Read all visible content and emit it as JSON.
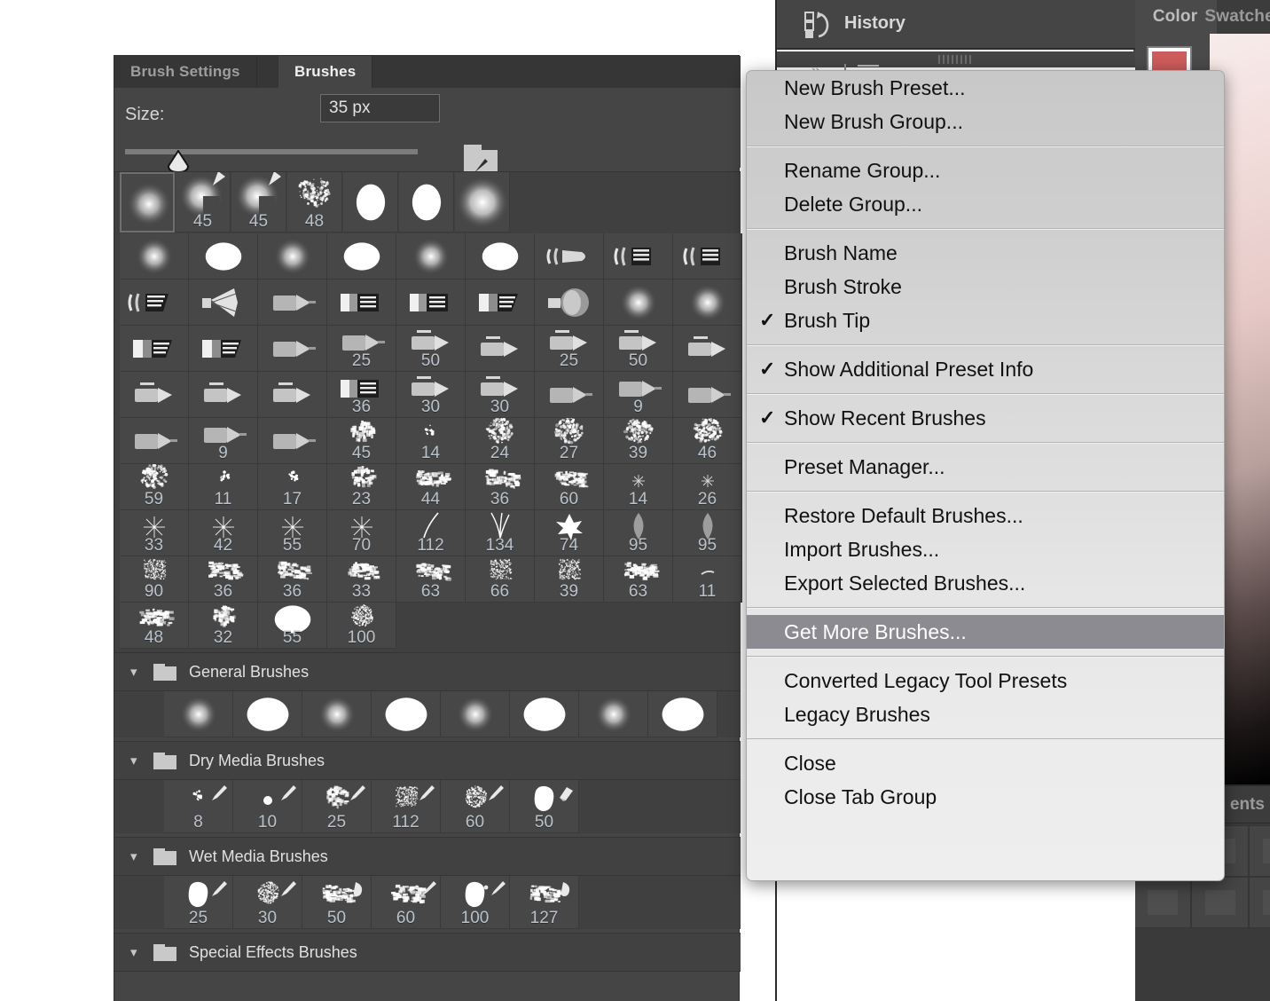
{
  "panel": {
    "tabs": [
      {
        "label": "Brush Settings",
        "active": false
      },
      {
        "label": "Brushes",
        "active": true
      }
    ],
    "collapse_icon": "»",
    "menu_icon": "hamburger-icon",
    "size": {
      "label": "Size:",
      "value": "35 px",
      "slider_percent": 18
    }
  },
  "recent_brushes": [
    {
      "num": "",
      "type": "soft-round"
    },
    {
      "num": "45",
      "type": "soft-round-tool"
    },
    {
      "num": "45",
      "type": "soft-round-tool"
    },
    {
      "num": "48",
      "type": "spatter"
    },
    {
      "num": "",
      "type": "hard-round"
    },
    {
      "num": "",
      "type": "hard-round"
    },
    {
      "num": "",
      "type": "soft-round-big"
    }
  ],
  "grid_rows": [
    [
      {
        "num": "",
        "type": "soft-round"
      },
      {
        "num": "",
        "type": "hard-round"
      },
      {
        "num": "",
        "type": "soft-round"
      },
      {
        "num": "",
        "type": "hard-round"
      },
      {
        "num": "",
        "type": "soft-round"
      },
      {
        "num": "",
        "type": "hard-round"
      },
      {
        "num": "",
        "type": "flat-tip-a"
      },
      {
        "num": "",
        "type": "flat-tip-b"
      },
      {
        "num": "",
        "type": "flat-tip-b"
      }
    ],
    [
      {
        "num": "",
        "type": "flat-tip-c"
      },
      {
        "num": "",
        "type": "fan-tip"
      },
      {
        "num": "",
        "type": "round-point"
      },
      {
        "num": "",
        "type": "block-tip"
      },
      {
        "num": "",
        "type": "block-tip"
      },
      {
        "num": "",
        "type": "angle-tip"
      },
      {
        "num": "",
        "type": "fan-wide"
      },
      {
        "num": "",
        "type": "soft-round"
      },
      {
        "num": "",
        "type": "soft-round"
      }
    ],
    [
      {
        "num": "",
        "type": "angle-tip"
      },
      {
        "num": "",
        "type": "angle-tip"
      },
      {
        "num": "",
        "type": "round-point"
      },
      {
        "num": "25",
        "type": "round-point"
      },
      {
        "num": "50",
        "type": "pencil-tip"
      },
      {
        "num": "",
        "type": "pencil-tip"
      },
      {
        "num": "25",
        "type": "pencil-tip"
      },
      {
        "num": "50",
        "type": "pencil-tip"
      },
      {
        "num": "",
        "type": "pencil-tip"
      }
    ],
    [
      {
        "num": "",
        "type": "pencil-tip"
      },
      {
        "num": "",
        "type": "pencil-tip"
      },
      {
        "num": "",
        "type": "pencil-tip"
      },
      {
        "num": "36",
        "type": "block-tip"
      },
      {
        "num": "30",
        "type": "pencil-tip"
      },
      {
        "num": "30",
        "type": "pencil-tip"
      },
      {
        "num": "",
        "type": "round-point"
      },
      {
        "num": "9",
        "type": "round-point"
      },
      {
        "num": "",
        "type": "round-point"
      }
    ],
    [
      {
        "num": "",
        "type": "round-point"
      },
      {
        "num": "9",
        "type": "round-point"
      },
      {
        "num": "",
        "type": "round-point"
      },
      {
        "num": "45",
        "type": "chalk"
      },
      {
        "num": "14",
        "type": "tiny-spatter"
      },
      {
        "num": "24",
        "type": "spatter"
      },
      {
        "num": "27",
        "type": "spatter"
      },
      {
        "num": "39",
        "type": "spatter"
      },
      {
        "num": "46",
        "type": "spatter"
      }
    ],
    [
      {
        "num": "59",
        "type": "spatter"
      },
      {
        "num": "11",
        "type": "tiny-spatter"
      },
      {
        "num": "17",
        "type": "tiny-spatter"
      },
      {
        "num": "23",
        "type": "chalk"
      },
      {
        "num": "44",
        "type": "stroke-texture"
      },
      {
        "num": "36",
        "type": "stroke-texture"
      },
      {
        "num": "60",
        "type": "stroke-texture"
      },
      {
        "num": "14",
        "type": "star-tiny"
      },
      {
        "num": "26",
        "type": "star-tiny"
      }
    ],
    [
      {
        "num": "33",
        "type": "star"
      },
      {
        "num": "42",
        "type": "star"
      },
      {
        "num": "55",
        "type": "star"
      },
      {
        "num": "70",
        "type": "star"
      },
      {
        "num": "112",
        "type": "grass-blade"
      },
      {
        "num": "134",
        "type": "grass"
      },
      {
        "num": "74",
        "type": "maple-leaf"
      },
      {
        "num": "95",
        "type": "leaf"
      },
      {
        "num": "95",
        "type": "leaf"
      }
    ],
    [
      {
        "num": "90",
        "type": "noise-block"
      },
      {
        "num": "36",
        "type": "stroke-texture"
      },
      {
        "num": "36",
        "type": "stroke-texture"
      },
      {
        "num": "33",
        "type": "stroke-texture"
      },
      {
        "num": "63",
        "type": "stroke-texture"
      },
      {
        "num": "66",
        "type": "noise-block"
      },
      {
        "num": "39",
        "type": "noise-block"
      },
      {
        "num": "63",
        "type": "stroke-texture"
      },
      {
        "num": "11",
        "type": "tiny-dash"
      }
    ],
    [
      {
        "num": "48",
        "type": "stroke-texture"
      },
      {
        "num": "32",
        "type": "chalk"
      },
      {
        "num": "55",
        "type": "hard-round"
      },
      {
        "num": "100",
        "type": "noise-round"
      }
    ]
  ],
  "groups": [
    {
      "label": "General Brushes",
      "expanded": true,
      "brushes": [
        {
          "num": "",
          "type": "soft-round"
        },
        {
          "num": "",
          "type": "hard-round-lg"
        },
        {
          "num": "",
          "type": "soft-round"
        },
        {
          "num": "",
          "type": "hard-round-lg"
        },
        {
          "num": "",
          "type": "soft-round"
        },
        {
          "num": "",
          "type": "hard-round-lg"
        },
        {
          "num": "",
          "type": "soft-round"
        },
        {
          "num": "",
          "type": "hard-round-lg"
        }
      ]
    },
    {
      "label": "Dry Media Brushes",
      "expanded": true,
      "brushes": [
        {
          "num": "8",
          "type": "tiny-spatter",
          "tool": "brush"
        },
        {
          "num": "10",
          "type": "dot",
          "tool": "brush"
        },
        {
          "num": "25",
          "type": "chalk",
          "tool": "brush"
        },
        {
          "num": "112",
          "type": "noise-block",
          "tool": "brush"
        },
        {
          "num": "60",
          "type": "noise-round",
          "tool": "brush"
        },
        {
          "num": "50",
          "type": "solid-blob",
          "tool": "eraser"
        }
      ]
    },
    {
      "label": "Wet Media Brushes",
      "expanded": true,
      "brushes": [
        {
          "num": "25",
          "type": "solid-blob",
          "tool": "brush"
        },
        {
          "num": "30",
          "type": "noise-round",
          "tool": "brush"
        },
        {
          "num": "50",
          "type": "stroke-texture",
          "tool": "smudge"
        },
        {
          "num": "60",
          "type": "stroke-texture",
          "tool": "mixer"
        },
        {
          "num": "100",
          "type": "solid-blob",
          "tool": "mixer"
        },
        {
          "num": "127",
          "type": "stroke-texture",
          "tool": "smudge"
        }
      ]
    },
    {
      "label": "Special Effects Brushes",
      "expanded": true,
      "brushes": []
    }
  ],
  "history": {
    "title": "History",
    "icon": "history-icon"
  },
  "color_panel": {
    "tabs": [
      {
        "label": "Color",
        "active": true
      },
      {
        "label": "Swatches",
        "active": false
      }
    ],
    "foreground_color": "#cd5c5c",
    "background_color": "#000000"
  },
  "documents_panel": {
    "tab_label": "ents"
  },
  "context_menu": {
    "highlight_color": "#8b8b91",
    "sections": [
      [
        {
          "label": "New Brush Preset...",
          "checked": false,
          "highlighted": false
        },
        {
          "label": "New Brush Group...",
          "checked": false,
          "highlighted": false
        }
      ],
      [
        {
          "label": "Rename Group...",
          "checked": false,
          "highlighted": false
        },
        {
          "label": "Delete Group...",
          "checked": false,
          "highlighted": false
        }
      ],
      [
        {
          "label": "Brush Name",
          "checked": false,
          "highlighted": false
        },
        {
          "label": "Brush Stroke",
          "checked": false,
          "highlighted": false
        },
        {
          "label": "Brush Tip",
          "checked": true,
          "highlighted": false
        }
      ],
      [
        {
          "label": "Show Additional Preset Info",
          "checked": true,
          "highlighted": false
        }
      ],
      [
        {
          "label": "Show Recent Brushes",
          "checked": true,
          "highlighted": false
        }
      ],
      [
        {
          "label": "Preset Manager...",
          "checked": false,
          "highlighted": false
        }
      ],
      [
        {
          "label": "Restore Default Brushes...",
          "checked": false,
          "highlighted": false
        },
        {
          "label": "Import Brushes...",
          "checked": false,
          "highlighted": false
        },
        {
          "label": "Export Selected Brushes...",
          "checked": false,
          "highlighted": false
        }
      ],
      [
        {
          "label": "Get More Brushes...",
          "checked": false,
          "highlighted": true
        }
      ],
      [
        {
          "label": "Converted Legacy Tool Presets",
          "checked": false,
          "highlighted": false
        },
        {
          "label": "Legacy Brushes",
          "checked": false,
          "highlighted": false
        }
      ],
      [
        {
          "label": "Close",
          "checked": false,
          "highlighted": false
        },
        {
          "label": "Close Tab Group",
          "checked": false,
          "highlighted": false
        }
      ]
    ]
  }
}
